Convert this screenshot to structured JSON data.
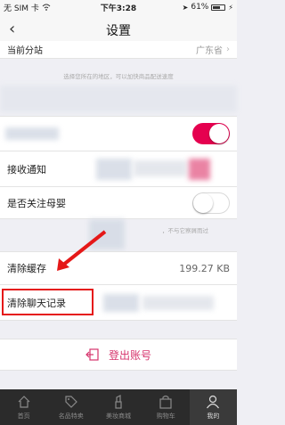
{
  "status_bar": {
    "carrier": "无 SIM 卡",
    "time": "下午3:28",
    "battery": "61%"
  },
  "nav": {
    "title": "设置",
    "back_icon": "chevron-left-icon"
  },
  "settings": {
    "branch_label": "当前分站",
    "branch_value": "广东省",
    "branch_hint": "选择您所在的地区，可以加快商品配送速度",
    "notify_label": "接收通知",
    "baby_label": "是否关注母婴",
    "baby_hint": "，不与它察屑而过",
    "cache_label": "清除缓存",
    "cache_value": "199.27 KB",
    "chat_label": "清除聊天记录",
    "logout_label": "登出账号"
  },
  "toggles": {
    "first": true,
    "baby": false
  },
  "colors": {
    "accent": "#e5004f",
    "highlight": "#e51818"
  },
  "tabs": [
    {
      "label": "首页",
      "icon": "home-icon"
    },
    {
      "label": "名品特卖",
      "icon": "tag-icon"
    },
    {
      "label": "美妆商城",
      "icon": "lipstick-icon"
    },
    {
      "label": "购物车",
      "icon": "bag-icon"
    },
    {
      "label": "我的",
      "icon": "person-icon"
    }
  ]
}
